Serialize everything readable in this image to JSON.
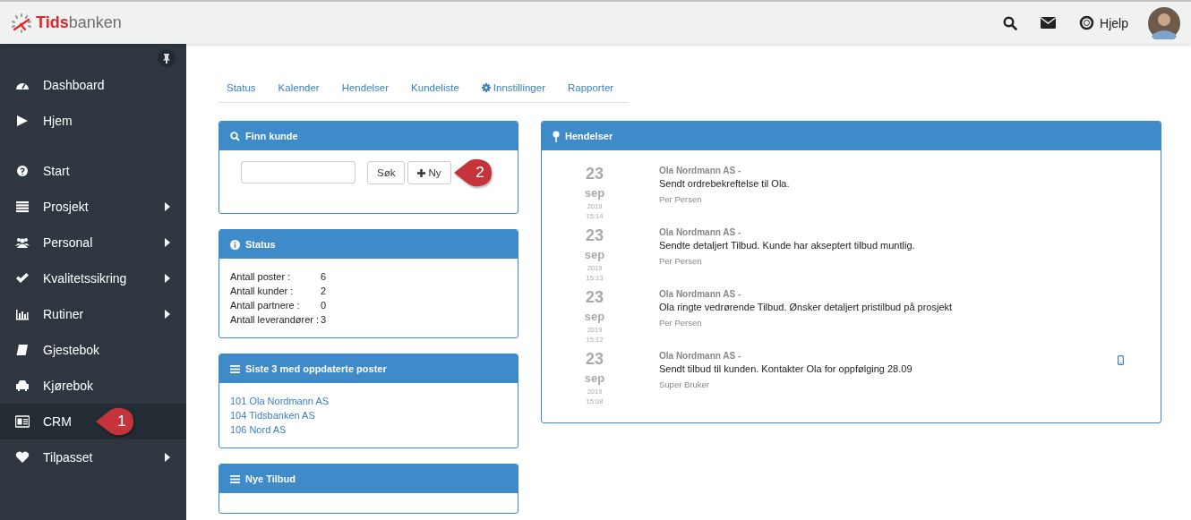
{
  "header": {
    "logo": {
      "strong": "Tids",
      "rest": "banken"
    },
    "help": "Hjelp"
  },
  "sidebar": {
    "groups": [
      {
        "items": [
          {
            "label": "Dashboard",
            "kind": "dashboard",
            "submenu": false,
            "selected": false
          },
          {
            "label": "Hjem",
            "kind": "play",
            "submenu": false,
            "selected": false
          }
        ]
      },
      {
        "items": [
          {
            "label": "Start",
            "kind": "question",
            "submenu": false,
            "selected": false
          },
          {
            "label": "Prosjekt",
            "kind": "list",
            "submenu": true,
            "selected": false
          },
          {
            "label": "Personal",
            "kind": "users",
            "submenu": true,
            "selected": false
          },
          {
            "label": "Kvalitetssikring",
            "kind": "check",
            "submenu": true,
            "selected": false
          },
          {
            "label": "Rutiner",
            "kind": "chart",
            "submenu": true,
            "selected": false
          },
          {
            "label": "Gjestebok",
            "kind": "book",
            "submenu": false,
            "selected": false
          },
          {
            "label": "Kjørebok",
            "kind": "car",
            "submenu": false,
            "selected": false
          },
          {
            "label": "CRM",
            "kind": "card",
            "submenu": false,
            "selected": true,
            "callout": "1"
          },
          {
            "label": "Tilpasset",
            "kind": "heart",
            "submenu": true,
            "selected": false
          }
        ]
      }
    ]
  },
  "tabs": [
    {
      "label": "Status",
      "kind": "plain"
    },
    {
      "label": "Kalender",
      "kind": "plain"
    },
    {
      "label": "Hendelser",
      "kind": "plain"
    },
    {
      "label": "Kundeliste",
      "kind": "plain"
    },
    {
      "label": "Innstillinger",
      "kind": "settings"
    },
    {
      "label": "Rapporter",
      "kind": "plain"
    }
  ],
  "find_customer": {
    "title": "Finn kunde",
    "search_button": "Søk",
    "new_button": "Ny",
    "callout": "2"
  },
  "status": {
    "title": "Status",
    "rows": [
      {
        "label": "Antall poster :",
        "value": "6"
      },
      {
        "label": "Antall kunder :",
        "value": "2"
      },
      {
        "label": "Antall partnere :",
        "value": "0"
      },
      {
        "label": "Antall leverandører :",
        "value": "3"
      }
    ]
  },
  "recent": {
    "title": "Siste 3 med oppdaterte poster",
    "links": [
      "101 Ola Nordmann AS",
      "104 Tidsbanken AS",
      "106 Nord AS"
    ]
  },
  "new_offers": {
    "title": "Nye Tilbud"
  },
  "events": {
    "title": "Hendelser",
    "items": [
      {
        "day": "23",
        "month": "sep",
        "year": "2019",
        "time": "15:14",
        "customer": "Ola Nordmann AS -",
        "text": "Sendt ordrebekreftelse til Ola.",
        "user": "Per Persen",
        "mobile": false
      },
      {
        "day": "23",
        "month": "sep",
        "year": "2019",
        "time": "15:13",
        "customer": "Ola Nordmann AS -",
        "text": "Sendte detaljert Tilbud. Kunde har akseptert tilbud muntlig.",
        "user": "Per Persen",
        "mobile": false
      },
      {
        "day": "23",
        "month": "sep",
        "year": "2019",
        "time": "15:12",
        "customer": "Ola Nordmann AS -",
        "text": "Ola ringte vedrørende Tilbud. Ønsker detaljert pristilbud på prosjekt",
        "user": "Per Persen",
        "mobile": false
      },
      {
        "day": "23",
        "month": "sep",
        "year": "2019",
        "time": "15:08",
        "customer": "Ola Nordmann AS -",
        "text": "Sendt tilbud til kunden. Kontakter Ola for oppfølging 28.09",
        "user": "Super Bruker",
        "mobile": true
      }
    ]
  }
}
